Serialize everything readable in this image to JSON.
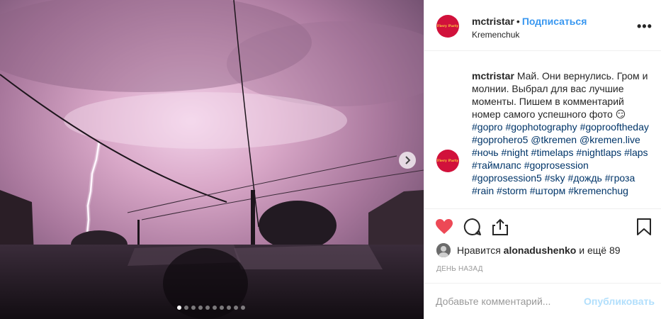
{
  "post": {
    "username": "mctristar",
    "separator": "•",
    "follow_label": "Подписаться",
    "location": "Kremenchuk",
    "more_icon": "•••",
    "avatar_text": "Fiery Party",
    "carousel": {
      "slide_count": 10,
      "active_index": 0
    }
  },
  "caption": {
    "username": "mctristar",
    "text": "Май. Они вернулись. Гром и молнии. Выбрал для вас лучшие моменты. Пишем в комментарий номер самого успешного фото 😏",
    "tags": [
      "#gopro",
      "#gophotography",
      "#goprooftheday",
      "#goprohero5",
      "@tkremen",
      "@kremen.live",
      "#ночь",
      "#night",
      "#timelaps",
      "#nightlaps",
      "#laps",
      "#таймлапс",
      "#goprosession",
      "#goprosession5",
      "#sky",
      "#дождь",
      "#гроза",
      "#rain",
      "#storm",
      "#шторм",
      "#kremenchug"
    ]
  },
  "likes": {
    "prefix": "Нравится",
    "user": "alonadushenko",
    "suffix": "и ещё 89"
  },
  "date": "ДЕНЬ НАЗАД",
  "comment_box": {
    "placeholder": "Добавьте комментарий...",
    "publish_label": "Опубликовать"
  },
  "colors": {
    "like_red": "#ed4956",
    "link_blue": "#3897f0",
    "hashtag": "#003569",
    "publish_disabled": "#b2dffc"
  }
}
